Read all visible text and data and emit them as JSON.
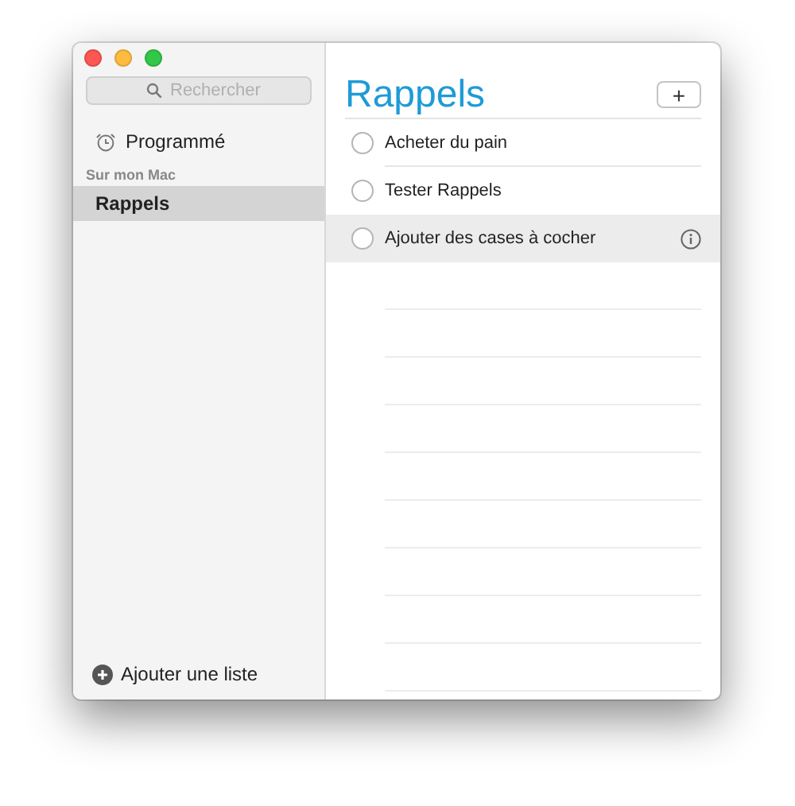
{
  "sidebar": {
    "search": {
      "placeholder": "Rechercher"
    },
    "smart_lists": [
      {
        "label": "Programmé",
        "selected": false
      }
    ],
    "section_title": "Sur mon Mac",
    "lists": [
      {
        "label": "Rappels",
        "selected": true
      }
    ],
    "add_list": "Ajouter une liste"
  },
  "main": {
    "title": "Rappels",
    "add_button": "+",
    "items": [
      {
        "text": "Acheter du pain",
        "checked": false,
        "selected": false
      },
      {
        "text": "Tester Rappels",
        "checked": false,
        "selected": false
      },
      {
        "text": "Ajouter des cases à cocher",
        "checked": false,
        "selected": true
      }
    ]
  }
}
